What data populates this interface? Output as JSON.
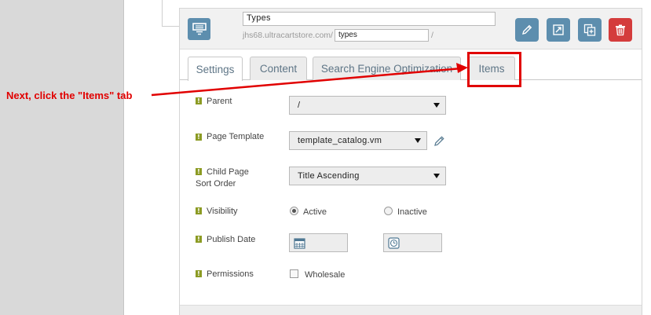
{
  "annotation": {
    "text": "Next, click the \"Items\" tab"
  },
  "header": {
    "title_value": "Types",
    "url_prefix": "jhs68.ultracartstore.com/",
    "slug_value": "types",
    "url_suffix": "/"
  },
  "header_buttons": [
    {
      "name": "edit",
      "icon": "pencil-icon"
    },
    {
      "name": "open",
      "icon": "external-link-icon"
    },
    {
      "name": "copy",
      "icon": "copy-plus-icon"
    },
    {
      "name": "delete",
      "icon": "trash-icon"
    }
  ],
  "tabs": [
    {
      "label": "Settings",
      "active": true
    },
    {
      "label": "Content",
      "active": false
    },
    {
      "label": "Search Engine Optimization",
      "active": false
    },
    {
      "label": "Items",
      "active": false
    }
  ],
  "form": {
    "parent": {
      "label": "Parent",
      "value": "/"
    },
    "page_template": {
      "label": "Page Template",
      "value": "template_catalog.vm"
    },
    "child_sort": {
      "label_line1": "Child Page",
      "label_line2": "Sort Order",
      "value": "Title Ascending"
    },
    "visibility": {
      "label": "Visibility",
      "option_active": "Active",
      "option_inactive": "Inactive",
      "selected": "Active"
    },
    "publish_date": {
      "label": "Publish Date"
    },
    "permissions": {
      "label": "Permissions",
      "checkbox_label": "Wholesale",
      "checked": false
    }
  },
  "colors": {
    "accent_blue": "#5d8eae",
    "delete_red": "#d43c3c",
    "annotation_red": "#e10000",
    "info_green": "#8c9b24"
  }
}
